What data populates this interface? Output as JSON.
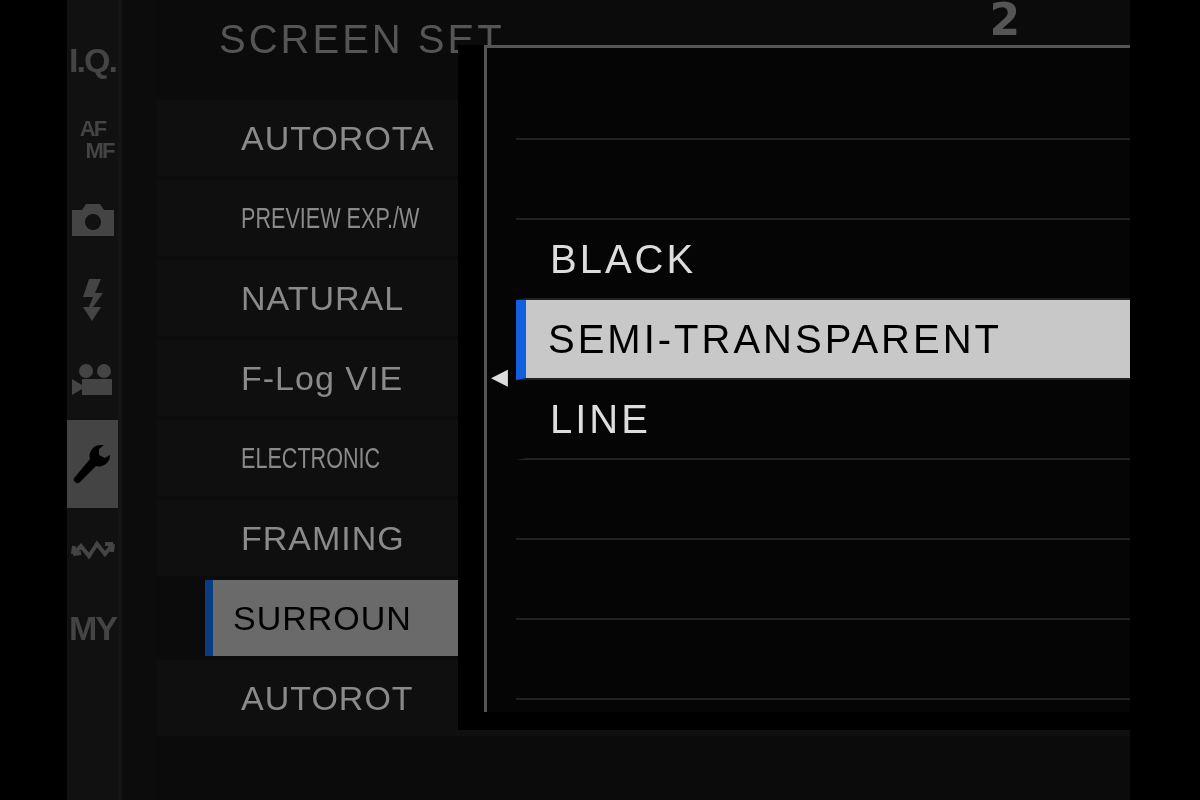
{
  "sidebar": {
    "tabs": [
      {
        "kind": "text",
        "lines": [
          "I.Q."
        ],
        "selected": false
      },
      {
        "kind": "text",
        "lines": [
          "AF",
          "MF"
        ],
        "selected": false
      },
      {
        "kind": "camera",
        "selected": false
      },
      {
        "kind": "flash",
        "selected": false
      },
      {
        "kind": "movie",
        "selected": false
      },
      {
        "kind": "wrench",
        "selected": true
      },
      {
        "kind": "wave",
        "selected": false
      },
      {
        "kind": "text",
        "lines": [
          "MY"
        ],
        "selected": false
      }
    ]
  },
  "menu": {
    "title": "SCREEN SET",
    "page": "2",
    "items": [
      {
        "label": "AUTOROTA",
        "condensed": false,
        "selected": false
      },
      {
        "label": "PREVIEW EXP./W",
        "condensed": true,
        "selected": false
      },
      {
        "label": "NATURAL",
        "condensed": false,
        "selected": false
      },
      {
        "label": "F-Log VIE",
        "condensed": false,
        "selected": false
      },
      {
        "label": "ELECTRONIC",
        "condensed": true,
        "selected": false
      },
      {
        "label": "FRAMING",
        "condensed": false,
        "selected": false
      },
      {
        "label": "SURROUN",
        "condensed": false,
        "selected": true
      },
      {
        "label": "AUTOROT",
        "condensed": false,
        "selected": false
      }
    ]
  },
  "popup": {
    "pointer": "◀",
    "options": [
      {
        "label": "BLACK",
        "selected": false
      },
      {
        "label": "SEMI-TRANSPARENT",
        "selected": true
      },
      {
        "label": "LINE",
        "selected": false
      }
    ]
  }
}
